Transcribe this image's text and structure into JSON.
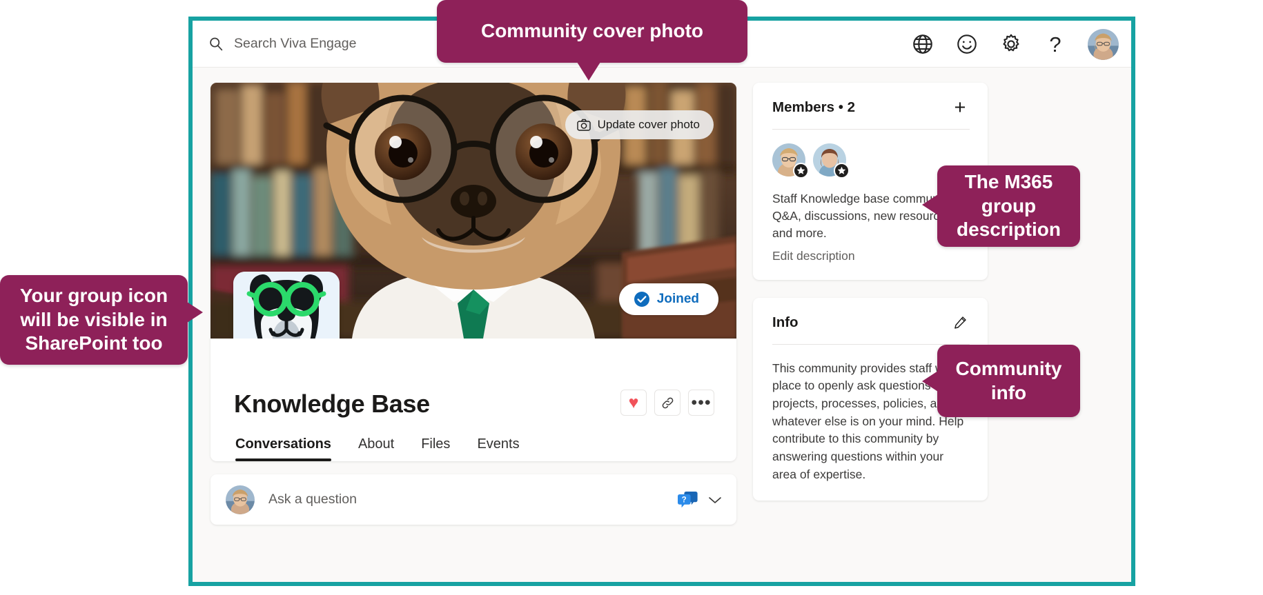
{
  "colors": {
    "frame_teal": "#17a2a2",
    "callout_magenta": "#8e2159",
    "joined_blue": "#0f6cbd",
    "heart_red": "#f1525a",
    "group_icon_green": "#2bd96b",
    "group_icon_bg": "#eaf3fb"
  },
  "header": {
    "search": {
      "placeholder": "Search Viva Engage",
      "value": "",
      "icon": "search-icon"
    },
    "actions": [
      {
        "name": "globe-icon",
        "label": "Language"
      },
      {
        "name": "smiley-icon",
        "label": "Feedback"
      },
      {
        "name": "gear-icon",
        "label": "Settings"
      },
      {
        "name": "question-mark-icon",
        "label": "?"
      }
    ],
    "avatar_name": "user-avatar"
  },
  "community": {
    "title": "Knowledge Base",
    "cover": {
      "update_button_label": "Update cover photo",
      "camera_icon": "camera-icon",
      "alt": "French bulldog wearing round glasses and a green tie in a library"
    },
    "joined_button_label": "Joined",
    "group_icon_alt": "Dog face with green glasses group icon",
    "title_actions": [
      {
        "name": "heart-icon",
        "glyph": "♥"
      },
      {
        "name": "link-icon",
        "glyph": "link"
      },
      {
        "name": "more-options-icon",
        "glyph": "•••"
      }
    ],
    "tabs": [
      {
        "label": "Conversations",
        "active": true
      },
      {
        "label": "About",
        "active": false
      },
      {
        "label": "Files",
        "active": false
      },
      {
        "label": "Events",
        "active": false
      }
    ]
  },
  "composer": {
    "placeholder": "Ask a question",
    "value": "",
    "question_icon": "question-bubble-icon",
    "chevron_icon": "chevron-down-icon"
  },
  "members_panel": {
    "title": "Members",
    "separator": "•",
    "count": "2",
    "add_icon": "plus-icon",
    "members": [
      {
        "name": "member-avatar-1",
        "badge": "star-badge"
      },
      {
        "name": "member-avatar-2",
        "badge": "star-badge"
      }
    ],
    "description": "Staff Knowledge base community for Q&A, discussions, new resources and more.",
    "edit_link_label": "Edit description"
  },
  "info_panel": {
    "title": "Info",
    "edit_icon": "pencil-icon",
    "body": "This community provides staff with a place to openly ask questions about projects, processes, policies, and whatever else is on your mind.  Help contribute to this community by answering questions within your area of expertise."
  },
  "callouts": {
    "cover": "Community cover photo",
    "group_icon": "Your group icon will be visible in SharePoint too",
    "description": "The M365 group description",
    "info": "Community info"
  }
}
